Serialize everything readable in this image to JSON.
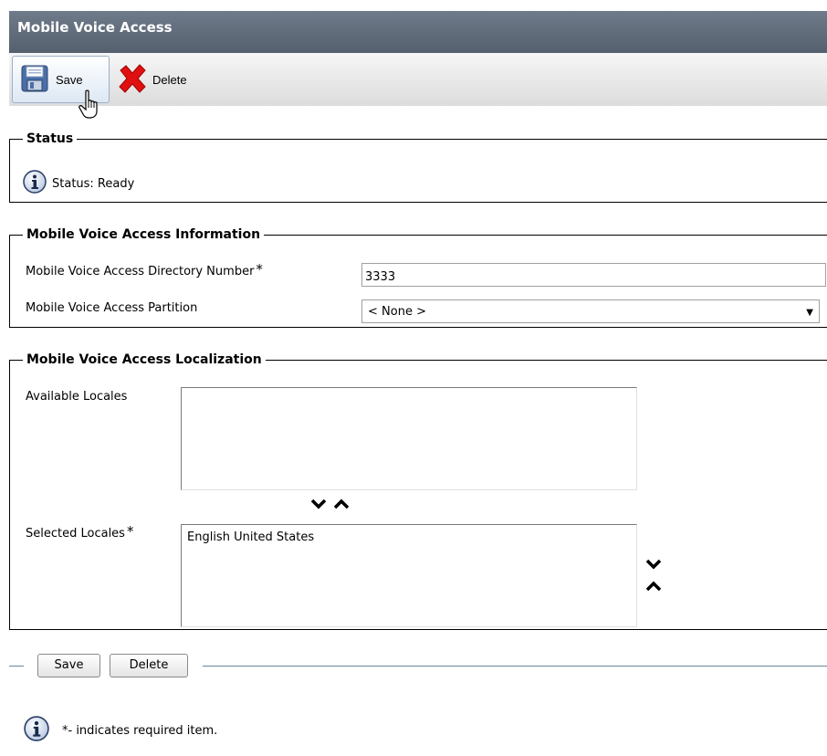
{
  "header": {
    "title": "Mobile Voice Access"
  },
  "toolbar": {
    "save_label": "Save",
    "delete_label": "Delete",
    "save_icon": "floppy-disk-icon",
    "delete_icon": "red-x-icon"
  },
  "status": {
    "legend": "Status",
    "text": "Status: Ready",
    "icon": "info-icon"
  },
  "info": {
    "legend": "Mobile Voice Access Information",
    "dn_label": "Mobile Voice Access Directory Number",
    "dn_value": "3333",
    "partition_label": "Mobile Voice Access Partition",
    "partition_value": "< None >",
    "required_mark": "*"
  },
  "localization": {
    "legend": "Mobile Voice Access Localization",
    "available_label": "Available Locales",
    "available_items": [],
    "selected_label": "Selected Locales",
    "selected_items": [
      "English United States"
    ],
    "required_mark": "*"
  },
  "bottom": {
    "save_label": "Save",
    "delete_label": "Delete"
  },
  "footer": {
    "note": "*- indicates required item."
  },
  "colors": {
    "titlebar": "#5f6a78",
    "delete_x": "#e01010"
  }
}
